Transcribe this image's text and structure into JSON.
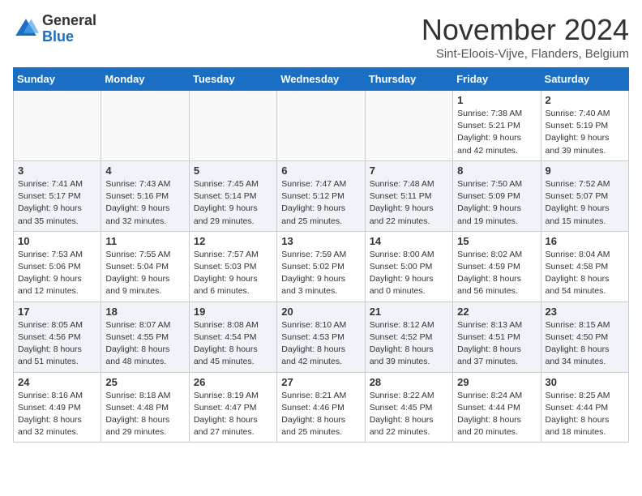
{
  "logo": {
    "general": "General",
    "blue": "Blue"
  },
  "title": "November 2024",
  "location": "Sint-Eloois-Vijve, Flanders, Belgium",
  "days_of_week": [
    "Sunday",
    "Monday",
    "Tuesday",
    "Wednesday",
    "Thursday",
    "Friday",
    "Saturday"
  ],
  "weeks": [
    [
      {
        "day": "",
        "info": ""
      },
      {
        "day": "",
        "info": ""
      },
      {
        "day": "",
        "info": ""
      },
      {
        "day": "",
        "info": ""
      },
      {
        "day": "",
        "info": ""
      },
      {
        "day": "1",
        "info": "Sunrise: 7:38 AM\nSunset: 5:21 PM\nDaylight: 9 hours\nand 42 minutes."
      },
      {
        "day": "2",
        "info": "Sunrise: 7:40 AM\nSunset: 5:19 PM\nDaylight: 9 hours\nand 39 minutes."
      }
    ],
    [
      {
        "day": "3",
        "info": "Sunrise: 7:41 AM\nSunset: 5:17 PM\nDaylight: 9 hours\nand 35 minutes."
      },
      {
        "day": "4",
        "info": "Sunrise: 7:43 AM\nSunset: 5:16 PM\nDaylight: 9 hours\nand 32 minutes."
      },
      {
        "day": "5",
        "info": "Sunrise: 7:45 AM\nSunset: 5:14 PM\nDaylight: 9 hours\nand 29 minutes."
      },
      {
        "day": "6",
        "info": "Sunrise: 7:47 AM\nSunset: 5:12 PM\nDaylight: 9 hours\nand 25 minutes."
      },
      {
        "day": "7",
        "info": "Sunrise: 7:48 AM\nSunset: 5:11 PM\nDaylight: 9 hours\nand 22 minutes."
      },
      {
        "day": "8",
        "info": "Sunrise: 7:50 AM\nSunset: 5:09 PM\nDaylight: 9 hours\nand 19 minutes."
      },
      {
        "day": "9",
        "info": "Sunrise: 7:52 AM\nSunset: 5:07 PM\nDaylight: 9 hours\nand 15 minutes."
      }
    ],
    [
      {
        "day": "10",
        "info": "Sunrise: 7:53 AM\nSunset: 5:06 PM\nDaylight: 9 hours\nand 12 minutes."
      },
      {
        "day": "11",
        "info": "Sunrise: 7:55 AM\nSunset: 5:04 PM\nDaylight: 9 hours\nand 9 minutes."
      },
      {
        "day": "12",
        "info": "Sunrise: 7:57 AM\nSunset: 5:03 PM\nDaylight: 9 hours\nand 6 minutes."
      },
      {
        "day": "13",
        "info": "Sunrise: 7:59 AM\nSunset: 5:02 PM\nDaylight: 9 hours\nand 3 minutes."
      },
      {
        "day": "14",
        "info": "Sunrise: 8:00 AM\nSunset: 5:00 PM\nDaylight: 9 hours\nand 0 minutes."
      },
      {
        "day": "15",
        "info": "Sunrise: 8:02 AM\nSunset: 4:59 PM\nDaylight: 8 hours\nand 56 minutes."
      },
      {
        "day": "16",
        "info": "Sunrise: 8:04 AM\nSunset: 4:58 PM\nDaylight: 8 hours\nand 54 minutes."
      }
    ],
    [
      {
        "day": "17",
        "info": "Sunrise: 8:05 AM\nSunset: 4:56 PM\nDaylight: 8 hours\nand 51 minutes."
      },
      {
        "day": "18",
        "info": "Sunrise: 8:07 AM\nSunset: 4:55 PM\nDaylight: 8 hours\nand 48 minutes."
      },
      {
        "day": "19",
        "info": "Sunrise: 8:08 AM\nSunset: 4:54 PM\nDaylight: 8 hours\nand 45 minutes."
      },
      {
        "day": "20",
        "info": "Sunrise: 8:10 AM\nSunset: 4:53 PM\nDaylight: 8 hours\nand 42 minutes."
      },
      {
        "day": "21",
        "info": "Sunrise: 8:12 AM\nSunset: 4:52 PM\nDaylight: 8 hours\nand 39 minutes."
      },
      {
        "day": "22",
        "info": "Sunrise: 8:13 AM\nSunset: 4:51 PM\nDaylight: 8 hours\nand 37 minutes."
      },
      {
        "day": "23",
        "info": "Sunrise: 8:15 AM\nSunset: 4:50 PM\nDaylight: 8 hours\nand 34 minutes."
      }
    ],
    [
      {
        "day": "24",
        "info": "Sunrise: 8:16 AM\nSunset: 4:49 PM\nDaylight: 8 hours\nand 32 minutes."
      },
      {
        "day": "25",
        "info": "Sunrise: 8:18 AM\nSunset: 4:48 PM\nDaylight: 8 hours\nand 29 minutes."
      },
      {
        "day": "26",
        "info": "Sunrise: 8:19 AM\nSunset: 4:47 PM\nDaylight: 8 hours\nand 27 minutes."
      },
      {
        "day": "27",
        "info": "Sunrise: 8:21 AM\nSunset: 4:46 PM\nDaylight: 8 hours\nand 25 minutes."
      },
      {
        "day": "28",
        "info": "Sunrise: 8:22 AM\nSunset: 4:45 PM\nDaylight: 8 hours\nand 22 minutes."
      },
      {
        "day": "29",
        "info": "Sunrise: 8:24 AM\nSunset: 4:44 PM\nDaylight: 8 hours\nand 20 minutes."
      },
      {
        "day": "30",
        "info": "Sunrise: 8:25 AM\nSunset: 4:44 PM\nDaylight: 8 hours\nand 18 minutes."
      }
    ]
  ]
}
